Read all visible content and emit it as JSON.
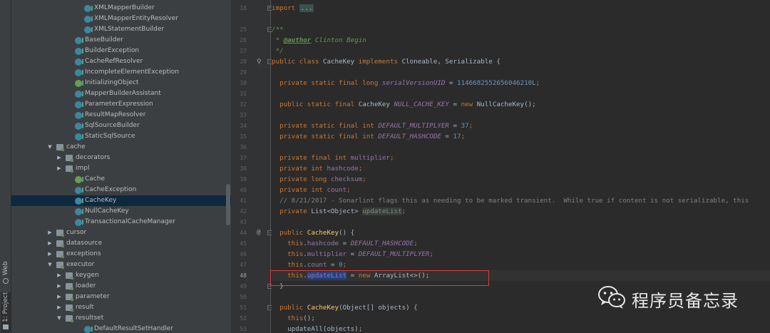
{
  "toolstrip": {
    "web_label": "Web",
    "project_label": "1: Project"
  },
  "tree": {
    "rows": [
      {
        "label": "XMLMapperBuilder",
        "kind": "cls",
        "arrow": ""
      },
      {
        "label": "XMLMapperEntityResolver",
        "kind": "cls",
        "arrow": ""
      },
      {
        "label": "XMLStatementBuilder",
        "kind": "cls",
        "arrow": ""
      },
      {
        "label": "BaseBuilder",
        "kind": "cls",
        "arrow": ""
      },
      {
        "label": "BuilderException",
        "kind": "cls",
        "arrow": ""
      },
      {
        "label": "CacheRefResolver",
        "kind": "cls",
        "arrow": ""
      },
      {
        "label": "IncompleteElementException",
        "kind": "cls",
        "arrow": ""
      },
      {
        "label": "InitializingObject",
        "kind": "iface",
        "arrow": ""
      },
      {
        "label": "MapperBuilderAssistant",
        "kind": "cls",
        "arrow": ""
      },
      {
        "label": "ParameterExpression",
        "kind": "cls",
        "arrow": ""
      },
      {
        "label": "ResultMapResolver",
        "kind": "cls",
        "arrow": ""
      },
      {
        "label": "SqlSourceBuilder",
        "kind": "cls",
        "arrow": ""
      },
      {
        "label": "StaticSqlSource",
        "kind": "cls",
        "arrow": ""
      },
      {
        "label": "cache",
        "kind": "folder",
        "arrow": "▼"
      },
      {
        "label": "decorators",
        "kind": "folder",
        "arrow": "▶"
      },
      {
        "label": "impl",
        "kind": "folder",
        "arrow": "▶"
      },
      {
        "label": "Cache",
        "kind": "iface",
        "arrow": ""
      },
      {
        "label": "CacheException",
        "kind": "cls",
        "arrow": ""
      },
      {
        "label": "CacheKey",
        "kind": "cls",
        "arrow": ""
      },
      {
        "label": "NullCacheKey",
        "kind": "cls",
        "arrow": ""
      },
      {
        "label": "TransactionalCacheManager",
        "kind": "cls",
        "arrow": ""
      },
      {
        "label": "cursor",
        "kind": "folder",
        "arrow": "▶"
      },
      {
        "label": "datasource",
        "kind": "folder",
        "arrow": "▶"
      },
      {
        "label": "exceptions",
        "kind": "folder",
        "arrow": "▶"
      },
      {
        "label": "executor",
        "kind": "folder",
        "arrow": "▼"
      },
      {
        "label": "keygen",
        "kind": "folder",
        "arrow": "▶"
      },
      {
        "label": "loader",
        "kind": "folder",
        "arrow": "▶"
      },
      {
        "label": "parameter",
        "kind": "folder",
        "arrow": "▶"
      },
      {
        "label": "result",
        "kind": "folder",
        "arrow": "▶"
      },
      {
        "label": "resultset",
        "kind": "folder",
        "arrow": "▼"
      },
      {
        "label": "DefaultResultSetHandler",
        "kind": "cls",
        "arrow": ""
      }
    ],
    "selected_label": "CacheKey"
  },
  "gutter": {
    "line_numbers": [
      "18",
      "25",
      "26",
      "27",
      "28",
      "29",
      "30",
      "31",
      "32",
      "33",
      "34",
      "35",
      "36",
      "37",
      "38",
      "39",
      "40",
      "41",
      "42",
      "43",
      "44",
      "45",
      "46",
      "47",
      "48",
      "49",
      "50",
      "51",
      "52",
      "53"
    ],
    "current_line": "48"
  },
  "code": {
    "l18_import": "import",
    "l18_fold": "...",
    "l25": "/**",
    "l26_star": " * ",
    "l26_tag": "@author",
    "l26_name": " Clinton Begin",
    "l27": " */",
    "l28_public": "public class",
    "l28_name": " CacheKey ",
    "l28_implements": "implements",
    "l28_rest": " Cloneable, Serializable {",
    "l30_mods": "  private static final long",
    "l30_field": "serialVersionUID",
    "l30_eq": " = ",
    "l30_num": "1146682552656046210L",
    "l30_end": ";",
    "l32_mods": "  public static final",
    "l32_type": " CacheKey ",
    "l32_field": "NULL_CACHE_KEY",
    "l32_eq": " = ",
    "l32_new": "new",
    "l32_rest": " NullCacheKey();",
    "l34_mods": "  private static final int",
    "l34_field": "DEFAULT_MULTIPLYER",
    "l34_eq": " = ",
    "l34_num": "37",
    "l34_end": ";",
    "l35_mods": "  private static final int",
    "l35_field": "DEFAULT_HASHCODE",
    "l35_eq": " = ",
    "l35_num": "17",
    "l35_end": ";",
    "l37_mods": "  private final int",
    "l37_field": " multiplier",
    "l37_end": ";",
    "l38_mods": "  private int",
    "l38_field": " hashcode",
    "l38_end": ";",
    "l39_mods": "  private long",
    "l39_field": " checksum",
    "l39_end": ";",
    "l40_mods": "  private int",
    "l40_field": " count",
    "l40_end": ";",
    "l41": "  // 8/21/2017 - Sonarlint flags this as needing to be marked transient.  While true if content is not serializable, this",
    "l42_mods": "  private",
    "l42_type": " List<Object> ",
    "l42_field": "updateList",
    "l42_end": ";",
    "l44_mods": "  public",
    "l44_name": " CacheKey",
    "l44_rest": "() {",
    "l45_this": "    this",
    "l45_dot": ".",
    "l45_field": "hashcode",
    "l45_eq": " = ",
    "l45_const": "DEFAULT_HASHCODE",
    "l45_end": ";",
    "l46_this": "    this",
    "l46_dot": ".",
    "l46_field": "multiplier",
    "l46_eq": " = ",
    "l46_const": "DEFAULT_MULTIPLYER",
    "l46_end": ";",
    "l47_this": "    this",
    "l47_dot": ".",
    "l47_field": "count",
    "l47_eq": " = ",
    "l47_num": "0",
    "l47_end": ";",
    "l48_this": "    this",
    "l48_dot": ".",
    "l48_field": "updateList",
    "l48_eq": " = ",
    "l48_new": "new",
    "l48_rest": " ArrayList<>();",
    "l49": "  }",
    "l51_mods": "  public",
    "l51_name": " CacheKey",
    "l51_rest": "(Object[] objects) {",
    "l52_this": "    this",
    "l52_rest": "();",
    "l53": "    updateAll(objects);"
  },
  "watermark": {
    "text": "程序员备忘录",
    "logo_icon": "wechat-logo-icon"
  },
  "colors": {
    "highlight_box": "#e03b3b",
    "selection": "#0d293e"
  }
}
